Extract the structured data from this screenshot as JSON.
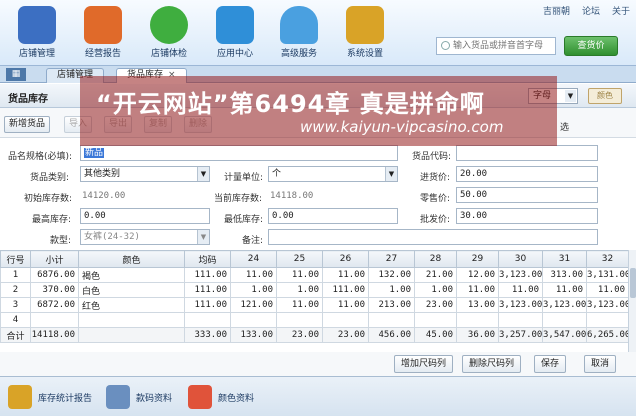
{
  "nav": {
    "items": [
      {
        "label": "店铺管理",
        "color": "#3c6fc2"
      },
      {
        "label": "经营报告",
        "color": "#e06a2a"
      },
      {
        "label": "店铺体检",
        "color": "#3fae3f"
      },
      {
        "label": "应用中心",
        "color": "#2f8fd8"
      },
      {
        "label": "高级服务",
        "color": "#4aa0e0"
      },
      {
        "label": "系统设置",
        "color": "#d9a327"
      }
    ]
  },
  "top_links": [
    "吉丽朝",
    "论坛",
    "关于"
  ],
  "search": {
    "placeholder": "输入货品或拼音首字母",
    "button": "查货价"
  },
  "tabs": [
    {
      "label": "店铺管理"
    },
    {
      "label": "货品库存"
    }
  ],
  "panel": {
    "title": "货品库存",
    "style_select": "字母",
    "right_button": "颜色"
  },
  "toolbar": {
    "buttons": [
      "新增货品",
      "导入",
      "导出",
      "复制",
      "删除"
    ],
    "right_hint": "选"
  },
  "form": {
    "name_label": "品名规格(必填):",
    "name_value": "新品",
    "code_label": "货品代码:",
    "code_value": "",
    "category_label": "货品类别:",
    "category_value": "其他类别",
    "unit_label": "计量单位:",
    "unit_value": "个",
    "cost_label": "进货价:",
    "cost_value": "20.00",
    "init_stock_label": "初始库存数:",
    "init_stock_value": "14120.00",
    "cur_stock_label": "当前库存数:",
    "cur_stock_value": "14118.00",
    "retail_label": "零售价:",
    "retail_value": "50.00",
    "min_stock_label": "最高库存:",
    "min_stock_value": "0.00",
    "max_stock_label": "最低库存:",
    "max_stock_value": "0.00",
    "wholesale_label": "批发价:",
    "wholesale_value": "30.00",
    "size_label": "款型:",
    "size_value": "女裤(24-32)",
    "note_label": "备注:",
    "note_value": ""
  },
  "grid": {
    "headers": [
      "行号",
      "小计",
      "颜色",
      "均码",
      "24",
      "25",
      "26",
      "27",
      "28",
      "29",
      "30",
      "31",
      "32"
    ],
    "rows": [
      [
        "1",
        "6876.00",
        "褐色",
        "111.00",
        "11.00",
        "11.00",
        "11.00",
        "132.00",
        "21.00",
        "12.00",
        "3,123.00",
        "313.00",
        "3,131.00"
      ],
      [
        "2",
        "370.00",
        "白色",
        "111.00",
        "1.00",
        "1.00",
        "111.00",
        "1.00",
        "1.00",
        "11.00",
        "11.00",
        "11.00",
        "11.00"
      ],
      [
        "3",
        "6872.00",
        "红色",
        "111.00",
        "121.00",
        "11.00",
        "11.00",
        "213.00",
        "23.00",
        "13.00",
        "3,123.00",
        "3,123.00",
        "3,123.00"
      ],
      [
        "4",
        "",
        "",
        "",
        "",
        "",
        "",
        "",
        "",
        "",
        "",
        "",
        ""
      ],
      [
        "合计",
        "14118.00",
        "",
        "333.00",
        "133.00",
        "23.00",
        "23.00",
        "456.00",
        "45.00",
        "36.00",
        "3,257.00",
        "3,547.00",
        "6,265.00"
      ]
    ]
  },
  "actions": {
    "add_col": "增加尺码列",
    "del_col": "删除尺码列",
    "save": "保存",
    "cancel": "取消"
  },
  "footer": {
    "items": [
      {
        "label": "库存统计报告",
        "color": "#d9a327"
      },
      {
        "label": "款码资料",
        "color": "#6a8fbf"
      },
      {
        "label": "颜色资料",
        "color": "#e0533a"
      }
    ]
  },
  "watermark": {
    "line1": "“开云网站”第6494章 真是拼命啊",
    "line2": "www.kaiyun-vipcasino.com"
  }
}
